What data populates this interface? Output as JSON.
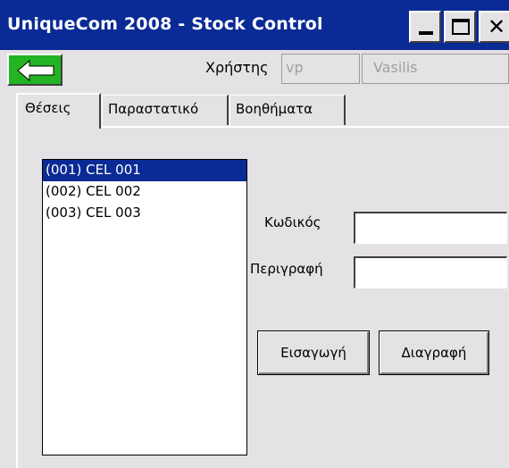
{
  "window": {
    "title": "UniqueCom 2008 - Stock Control",
    "controls": {
      "minimize": "minimize-icon",
      "maximize": "maximize-icon",
      "close": "close-icon"
    }
  },
  "header": {
    "back_icon": "arrow-left-icon",
    "user_label": "Χρήστης",
    "user_code": "vp",
    "user_name": "Vasilis"
  },
  "tabs": [
    {
      "label": "Θέσεις",
      "active": true
    },
    {
      "label": "Παραστατικό",
      "active": false
    },
    {
      "label": "Βοηθήματα",
      "active": false
    }
  ],
  "locations": {
    "items": [
      {
        "label": "(001) CEL 001",
        "selected": true
      },
      {
        "label": "(002) CEL 002",
        "selected": false
      },
      {
        "label": "(003) CEL 003",
        "selected": false
      }
    ]
  },
  "form": {
    "code_label": "Κωδικός",
    "code_value": "",
    "description_label": "Περιγραφή",
    "description_value": "",
    "insert_button": "Εισαγωγή",
    "delete_button": "Διαγραφή"
  },
  "colors": {
    "titlebar": "#0a2a95",
    "selection": "#0a2a95",
    "back_button": "#22b422",
    "face": "#e5e2e5"
  }
}
